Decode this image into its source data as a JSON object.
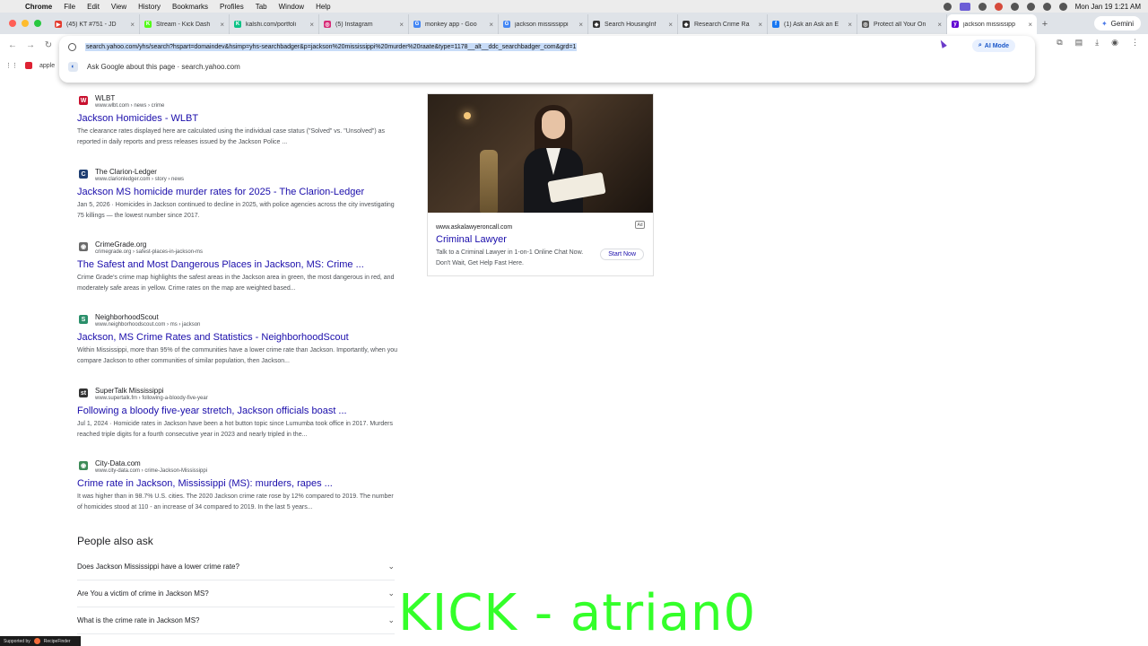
{
  "menubar": {
    "apple_icon": "apple-icon",
    "items": [
      "Chrome",
      "File",
      "Edit",
      "View",
      "History",
      "Bookmarks",
      "Profiles",
      "Tab",
      "Window",
      "Help"
    ],
    "clock": "Mon Jan 19  1:21 AM"
  },
  "tabs": [
    {
      "label": "(45) KT #751 - JD",
      "color": "#e33b2e",
      "glyph": "▶"
    },
    {
      "label": "Stream - Kick Dash",
      "color": "#53fc18",
      "glyph": "K"
    },
    {
      "label": "kalshi.com/portfoli",
      "color": "#09c285",
      "glyph": "K"
    },
    {
      "label": "(5) Instagram",
      "color": "#d62976",
      "glyph": "◎"
    },
    {
      "label": "monkey app - Goo",
      "color": "#4285f4",
      "glyph": "G"
    },
    {
      "label": "jackson mississippi",
      "color": "#4285f4",
      "glyph": "G"
    },
    {
      "label": "Search HousingInf",
      "color": "#333333",
      "glyph": "◆"
    },
    {
      "label": "Research Crime Ra",
      "color": "#333333",
      "glyph": "◆"
    },
    {
      "label": "(1) Ask an Ask an E",
      "color": "#1877f2",
      "glyph": "f"
    },
    {
      "label": "Protect all Your On",
      "color": "#555555",
      "glyph": "◎"
    },
    {
      "label": "jackson mississipp",
      "color": "#6001d2",
      "glyph": "y",
      "active": true
    }
  ],
  "gemini_label": "Gemini",
  "omnibox": {
    "url": "search.yahoo.com/yhs/search?hspart=domaindev&hsimp=yhs-searchbadger&p=jackson%20mississippi%20murder%20raate&type=1178__alt__ddc_searchbadger_com&grd=1",
    "ai_mode_label": "AI Mode",
    "ask_text": "Ask Google about this page · search.yahoo.com"
  },
  "bookmarks": {
    "first": "apple"
  },
  "results": [
    {
      "site": "WLBT",
      "url": "www.wlbt.com › news › crime",
      "title": "Jackson Homicides - WLBT",
      "snippet": "The clearance rates displayed here are calculated using the individual case status (\"Solved\" vs. \"Unsolved\") as reported in daily reports and press releases issued by the Jackson Police ...",
      "fav_color": "#c8102e",
      "fav_glyph": "W"
    },
    {
      "site": "The Clarion-Ledger",
      "url": "www.clarionledger.com › story › news",
      "title": "Jackson MS homicide murder rates for 2025 - The Clarion-Ledger",
      "snippet": "Jan 5, 2026 · Homicides in Jackson continued to decline in 2025, with police agencies across the city investigating 75 killings — the lowest number since 2017.",
      "fav_color": "#1f3f73",
      "fav_glyph": "C"
    },
    {
      "site": "CrimeGrade.org",
      "url": "crimegrade.org › safest-places-in-jackson-ms",
      "title": "The Safest and Most Dangerous Places in Jackson, MS: Crime ...",
      "snippet": "Crime Grade's crime map highlights the safest areas in the Jackson area in green, the most dangerous in red, and moderately safe areas in yellow. Crime rates on the map are weighted based...",
      "fav_color": "#6b6b6b",
      "fav_glyph": "◉"
    },
    {
      "site": "NeighborhoodScout",
      "url": "www.neighborhoodscout.com › ms › jackson",
      "title": "Jackson, MS Crime Rates and Statistics - NeighborhoodScout",
      "snippet": "Within Mississippi, more than 95% of the communities have a lower crime rate than Jackson. Importantly, when you compare Jackson to other communities of similar population, then Jackson...",
      "fav_color": "#2a8f6a",
      "fav_glyph": "S"
    },
    {
      "site": "SuperTalk Mississippi",
      "url": "www.supertalk.fm › following-a-bloody-five-year",
      "title": "Following a bloody five-year stretch, Jackson officials boast ...",
      "snippet": "Jul 1, 2024 · Homicide rates in Jackson have been a hot button topic since Lumumba took office in 2017. Murders reached triple digits for a fourth consecutive year in 2023 and nearly tripled in the...",
      "fav_color": "#333333",
      "fav_glyph": "st"
    },
    {
      "site": "City-Data.com",
      "url": "www.city-data.com › crime-Jackson-Mississippi",
      "title": "Crime rate in Jackson, Mississippi (MS): murders, rapes ...",
      "snippet": "It was higher than in 98.7% U.S. cities. The 2020 Jackson crime rate rose by 12% compared to 2019. The number of homicides stood at 110 - an increase of 34 compared to 2019. In the last 5 years...",
      "fav_color": "#3d8b57",
      "fav_glyph": "◉"
    }
  ],
  "people_also_ask": {
    "title": "People also ask",
    "questions": [
      "Does Jackson Mississippi have a lower crime rate?",
      "Are You a victim of crime in Jackson MS?",
      "What is the crime rate in Jackson MS?"
    ]
  },
  "ad": {
    "url": "www.askalawyeroncall.com",
    "badge": "Ad",
    "title": "Criminal Lawyer",
    "description": "Talk to a Criminal Lawyer in 1-on-1 Online Chat Now. Don't Wait, Get Help Fast Here.",
    "cta": "Start Now"
  },
  "overlay": {
    "stream_text": "KICK - atrian0",
    "supported_by": "Supported by",
    "sponsor": "RecipeFinder"
  }
}
